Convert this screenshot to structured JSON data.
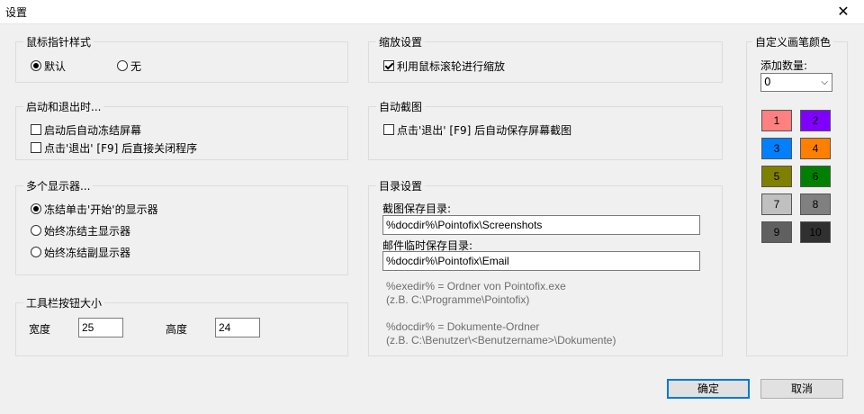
{
  "window": {
    "title": "设置",
    "close_glyph": "✕"
  },
  "pointer_style": {
    "legend": "鼠标指针样式",
    "options": [
      {
        "label": "默认",
        "selected": true
      },
      {
        "label": "无",
        "selected": false
      }
    ]
  },
  "startup": {
    "legend": "启动和退出时...",
    "options": [
      {
        "label": "启动后自动冻结屏幕",
        "checked": false
      },
      {
        "label": "点击'退出' [F9] 后直接关闭程序",
        "checked": false
      }
    ]
  },
  "monitors": {
    "legend": "多个显示器...",
    "options": [
      {
        "label": "冻结单击'开始'的显示器",
        "selected": true
      },
      {
        "label": "始终冻结主显示器",
        "selected": false
      },
      {
        "label": "始终冻结副显示器",
        "selected": false
      }
    ]
  },
  "toolbar_size": {
    "legend": "工具栏按钮大小",
    "width_label": "宽度",
    "width_value": "25",
    "height_label": "高度",
    "height_value": "24"
  },
  "zoom": {
    "legend": "缩放设置",
    "option": {
      "label": "利用鼠标滚轮进行缩放",
      "checked": true
    }
  },
  "auto_capture": {
    "legend": "自动截图",
    "option": {
      "label": "点击'退出' [F9] 后自动保存屏幕截图",
      "checked": false
    }
  },
  "directories": {
    "legend": "目录设置",
    "screenshot_label": "截图保存目录:",
    "screenshot_value": "%docdir%\\Pointofix\\Screenshots",
    "email_label": "邮件临时保存目录:",
    "email_value": "%docdir%\\Pointofix\\Email",
    "hints": [
      "%exedir% = Ordner von Pointofix.exe",
      "(z.B. C:\\Programme\\Pointofix)",
      "%docdir% = Dokumente-Ordner",
      "(z.B. C:\\Benutzer\\<Benutzername>\\Dokumente)"
    ]
  },
  "custom_colors": {
    "legend": "自定义画笔颜色",
    "count_label": "添加数量:",
    "count_value": "0",
    "swatches": [
      {
        "label": "1",
        "color": "#ff8080",
        "text_color": "#000000"
      },
      {
        "label": "2",
        "color": "#8000ff",
        "text_color": "#000000"
      },
      {
        "label": "3",
        "color": "#0080ff",
        "text_color": "#000000"
      },
      {
        "label": "4",
        "color": "#ff8000",
        "text_color": "#000000"
      },
      {
        "label": "5",
        "color": "#808000",
        "text_color": "#000000"
      },
      {
        "label": "6",
        "color": "#008000",
        "text_color": "#000000"
      },
      {
        "label": "7",
        "color": "#c0c0c0",
        "text_color": "#000000"
      },
      {
        "label": "8",
        "color": "#808080",
        "text_color": "#000000"
      },
      {
        "label": "9",
        "color": "#606060",
        "text_color": "#000000"
      },
      {
        "label": "10",
        "color": "#303030",
        "text_color": "#000000"
      }
    ]
  },
  "buttons": {
    "ok": "确定",
    "cancel": "取消"
  }
}
